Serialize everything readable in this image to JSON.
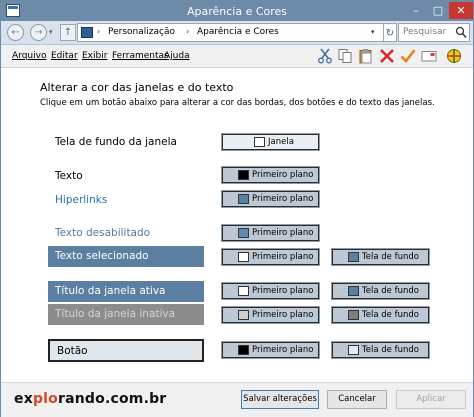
{
  "window": {
    "title": "Aparência e Cores",
    "controls": {
      "minimize": "–",
      "maximize": "□",
      "close": "✕"
    }
  },
  "address": {
    "back": "←",
    "forward": "→",
    "up": "↑",
    "crumbs": [
      "Personalização",
      "Aparência e Cores"
    ],
    "separator": "›",
    "dropdown": "▾",
    "refresh": "↻",
    "search_placeholder": "Pesquisar"
  },
  "menu": {
    "items": [
      "Arquivo",
      "Editar",
      "Exibir",
      "Ferramentas",
      "Ajuda"
    ]
  },
  "toolbar": {
    "icons": [
      "scissors-icon",
      "copy-icon",
      "paste-icon",
      "delete-icon",
      "check-icon",
      "email-icon",
      "target-icon"
    ]
  },
  "content": {
    "heading": "Alterar a cor das janelas e do texto",
    "subheading": "Clique em um botão abaixo para alterar a cor das bordas, dos botões e do texto das janelas.",
    "rows": [
      {
        "label": "Tela de fundo da janela",
        "style": "plain",
        "color": "#000000",
        "buttons": [
          {
            "text": "Janela",
            "swatch": "#ffffff"
          }
        ]
      },
      {
        "label": "Texto",
        "style": "plain",
        "color": "#000000",
        "buttons": [
          {
            "text": "Primeiro plano",
            "swatch": "#000000"
          }
        ]
      },
      {
        "label": "Hiperlinks",
        "style": "plain",
        "color": "#2e6fb5",
        "buttons": [
          {
            "text": "Primeiro plano",
            "swatch": "#5a7fa0"
          }
        ]
      },
      {
        "label": "Texto desabilitado",
        "style": "plain",
        "color": "#4e7aa3",
        "buttons": [
          {
            "text": "Primeiro plano",
            "swatch": "#5e8bb2"
          }
        ]
      },
      {
        "label": "Texto selecionado",
        "style": "band",
        "band": "#5a7fa0",
        "buttons": [
          {
            "text": "Primeiro plano",
            "swatch": "#ffffff"
          },
          {
            "text": "Tela de fundo",
            "swatch": "#5a7fa0"
          }
        ]
      },
      {
        "label": "Título da janela ativa",
        "style": "band",
        "band": "#5a7fa0",
        "buttons": [
          {
            "text": "Primeiro plano",
            "swatch": "#ffffff"
          },
          {
            "text": "Tela de fundo",
            "swatch": "#5a7fa0"
          }
        ]
      },
      {
        "label": "Título da janela inativa",
        "style": "band",
        "band": "#8c8c8c",
        "text_color": "#d4d4d4",
        "buttons": [
          {
            "text": "Primeiro plano",
            "swatch": "#d0d0d0"
          },
          {
            "text": "Tela de fundo",
            "swatch": "#7e7e7e"
          }
        ]
      },
      {
        "label": "Botão",
        "style": "button",
        "band": "#e2e7ec",
        "buttons": [
          {
            "text": "Primeiro plano",
            "swatch": "#000000"
          },
          {
            "text": "Tela de fundo",
            "swatch": "#e6ebf0"
          }
        ]
      }
    ]
  },
  "footer": {
    "brand_ex": "ex",
    "brand_plo": "plo",
    "brand_rest": "rando.com.br",
    "save": "Salvar alterações",
    "cancel": "Cancelar",
    "apply": "Aplicar"
  }
}
